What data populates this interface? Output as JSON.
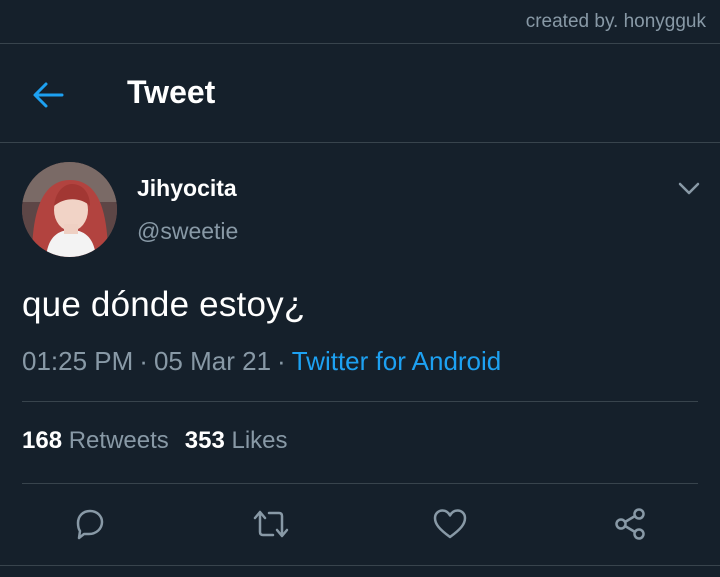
{
  "watermark": "created by. honygguk",
  "header": {
    "title": "Tweet",
    "back_icon": "arrow-left-icon"
  },
  "tweet": {
    "display_name": "Jihyocita",
    "handle": "@sweetie",
    "text": "que dónde estoy¿",
    "time": "01:25 PM",
    "date": "05 Mar 21",
    "separator": "·",
    "source": "Twitter for Android"
  },
  "stats": {
    "retweets_count": "168",
    "retweets_label": "Retweets",
    "likes_count": "353",
    "likes_label": "Likes"
  },
  "actions": [
    "reply-icon",
    "retweet-icon",
    "like-icon",
    "share-icon"
  ],
  "colors": {
    "background": "#15202b",
    "accent": "#1da1f2",
    "muted": "#8899a6",
    "divider": "#38444d"
  }
}
